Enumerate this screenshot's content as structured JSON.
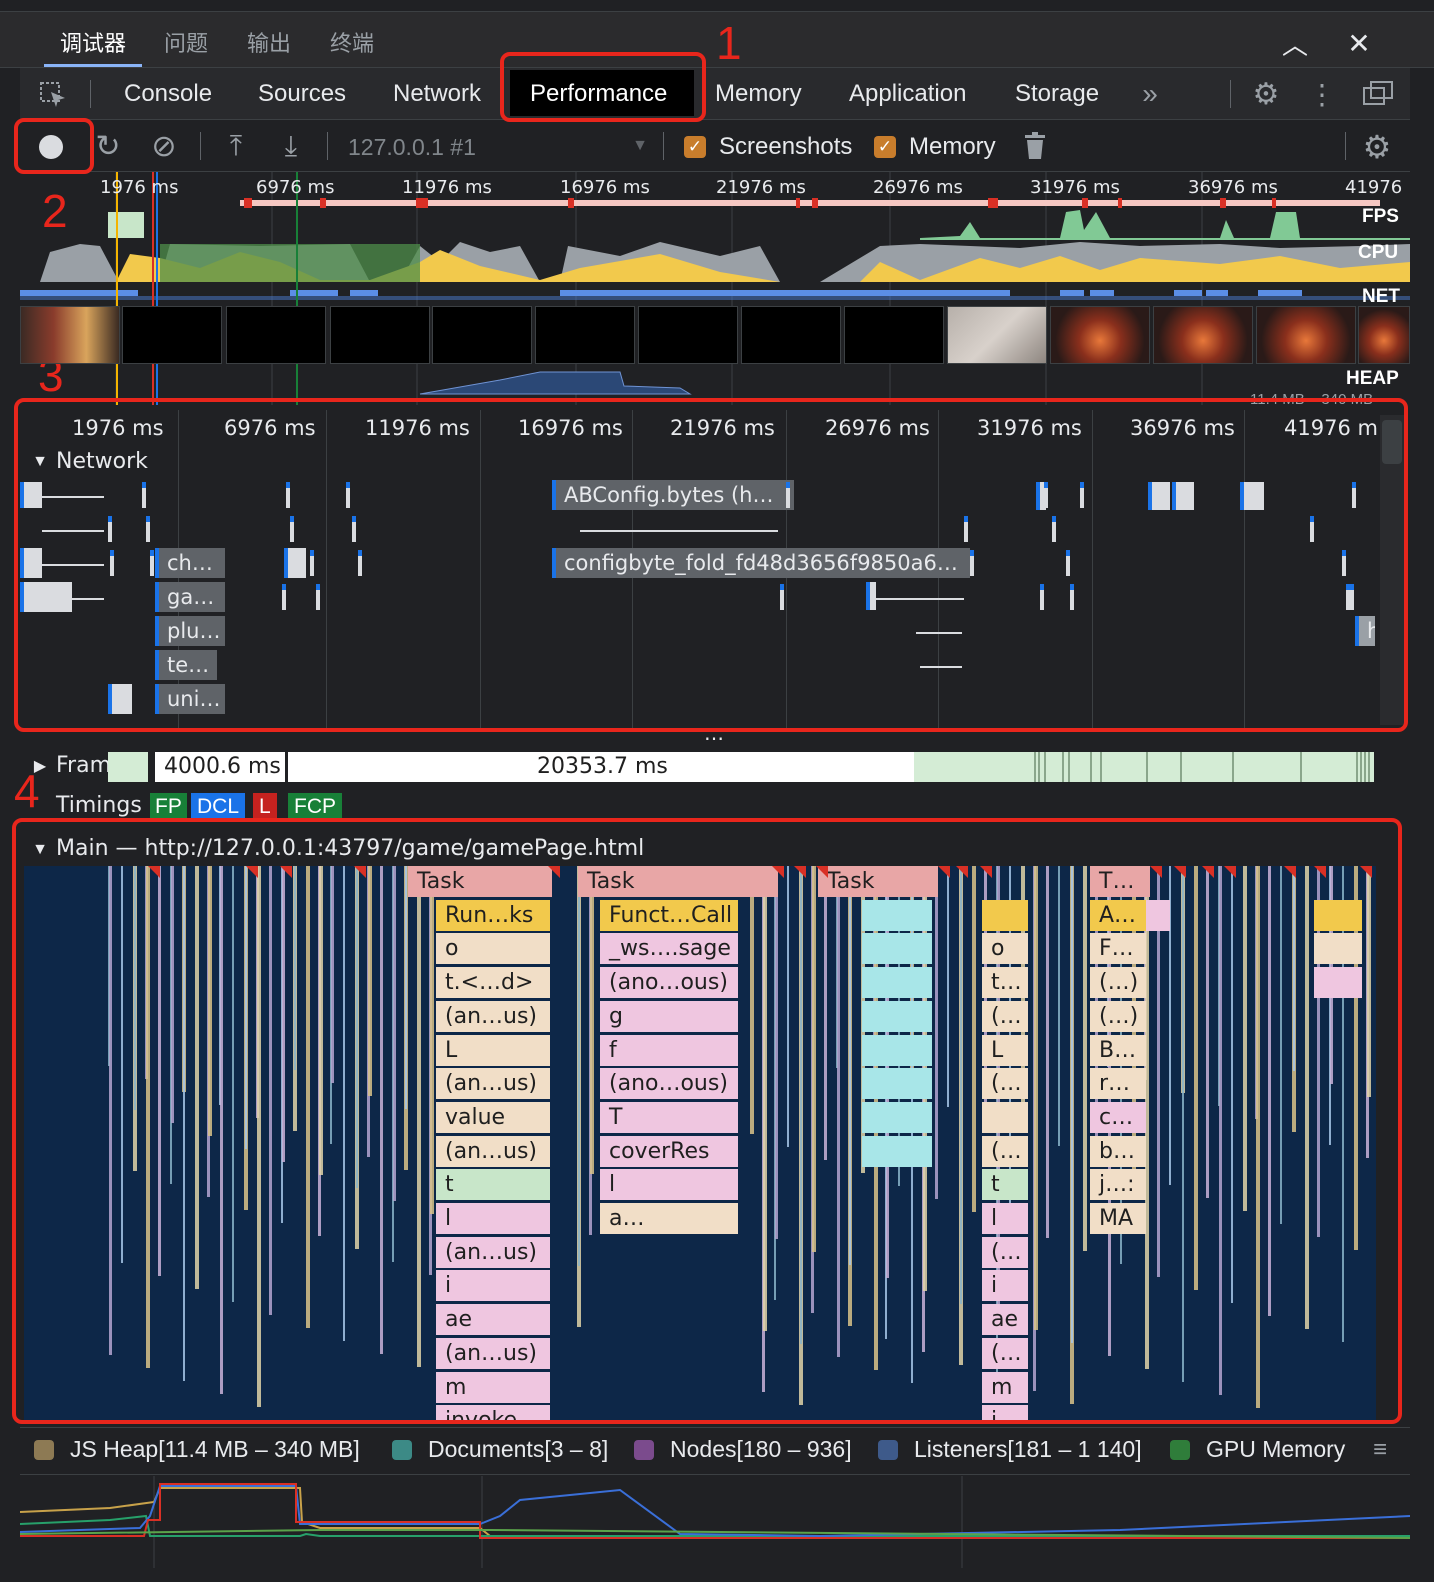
{
  "drawer_tabs": {
    "debugger": "调试器",
    "issues": "问题",
    "output": "输出",
    "terminal": "终端"
  },
  "panel_tabs": [
    "Console",
    "Sources",
    "Network",
    "Performance",
    "Memory",
    "Application",
    "Storage"
  ],
  "active_tab": "Performance",
  "toolbar": {
    "target": "127.0.0.1 #1",
    "screenshots_label": "Screenshots",
    "memory_label": "Memory",
    "screenshots_checked": true,
    "memory_checked": true
  },
  "overview": {
    "ticks": [
      "1976 ms",
      "6976 ms",
      "11976 ms",
      "16976 ms",
      "21976 ms",
      "26976 ms",
      "31976 ms",
      "36976 ms",
      "41976"
    ],
    "fps_label": "FPS",
    "cpu_label": "CPU",
    "net_label": "NET",
    "heap_label": "HEAP",
    "heap_range": "11.4 MB – 340 MB"
  },
  "timeline": {
    "ticks": [
      "1976 ms",
      "6976 ms",
      "11976 ms",
      "16976 ms",
      "21976 ms",
      "26976 ms",
      "31976 ms",
      "36976 ms",
      "41976 m"
    ],
    "network_label": "Network",
    "requests": [
      "ABConfig.bytes (h…",
      "configbyte_fold_fd48d3656f9850a6…",
      "ch…",
      "ga…",
      "plu…",
      "te…",
      "uni…",
      "h"
    ],
    "frames_label": "Frames",
    "frames": [
      "4000.6 ms",
      "20353.7 ms"
    ],
    "timings_label": "Timings",
    "timings": [
      "FP",
      "DCL",
      "L",
      "FCP"
    ],
    "main_label": "Main — http://127.0.0.1:43797/game/gamePage.html"
  },
  "flame": {
    "task": "Task",
    "col1": [
      "Run…ks",
      "o",
      "t.<…d>",
      "(an…us)",
      "L",
      "(an…us)",
      "value",
      "(an…us)",
      "t",
      "l",
      "(an…us)",
      "i",
      "ae",
      "(an…us)",
      "m",
      "invoke"
    ],
    "col2": [
      "Funct…Call",
      "_ws….sage",
      "(ano…ous)",
      "g",
      "f",
      "(ano…ous)",
      "T",
      "coverRes",
      "l",
      "a…"
    ],
    "col3": [
      "",
      "o",
      "t…",
      "(…",
      "L",
      "(…",
      "",
      "(…",
      "t",
      "l",
      "(…",
      "i",
      "ae",
      "(…",
      "m",
      "i"
    ],
    "col4": [
      "T…",
      "A…",
      "F…",
      "(…)",
      "(…)",
      "B…",
      "r…",
      "c…",
      "b…",
      "j…:",
      "MA"
    ]
  },
  "legend": [
    {
      "label": "JS Heap[11.4 MB – 340 MB]",
      "color": "#8d7a54"
    },
    {
      "label": "Documents[3 – 8]",
      "color": "#3c8a86"
    },
    {
      "label": "Nodes[180 – 936]",
      "color": "#7b4b8d"
    },
    {
      "label": "Listeners[181 – 1 140]",
      "color": "#3e5a8a"
    },
    {
      "label": "GPU Memory",
      "color": "#2f7d3a"
    }
  ],
  "annotations": [
    "1",
    "2",
    "3",
    "4"
  ]
}
